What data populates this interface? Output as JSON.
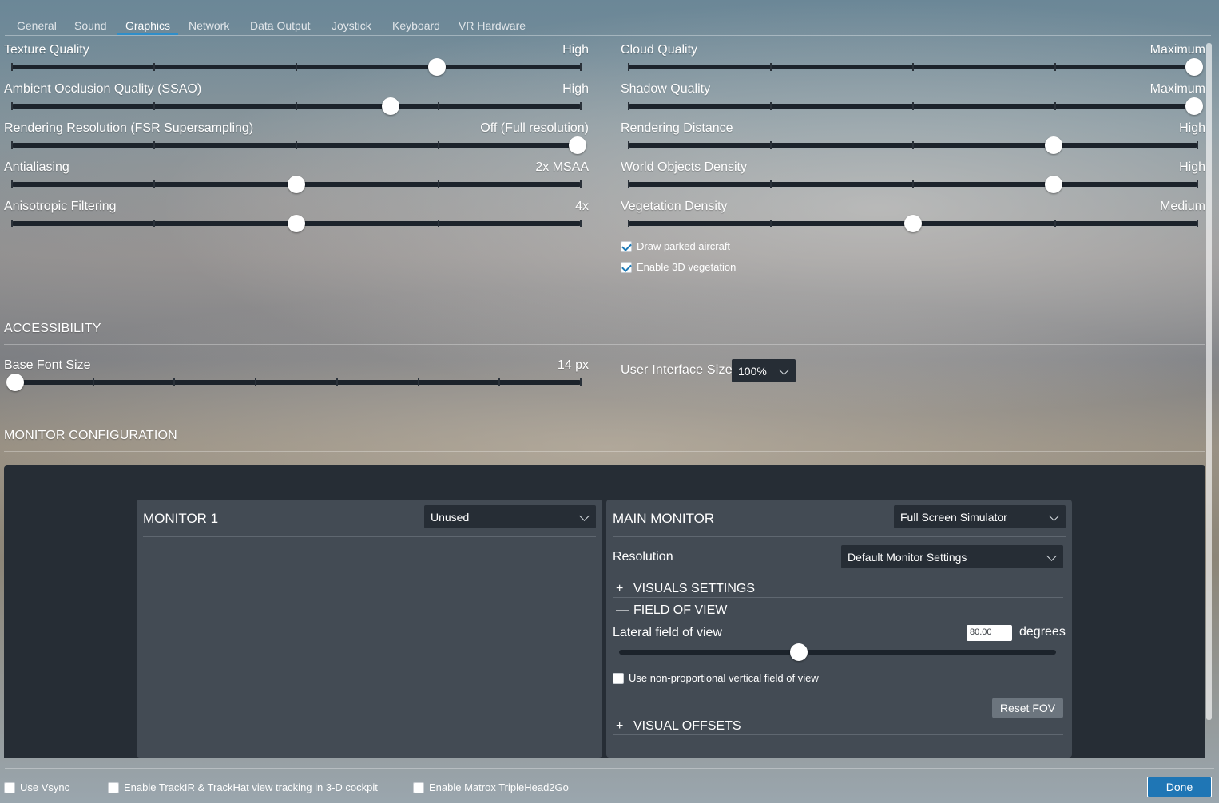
{
  "tabs": [
    "General",
    "Sound",
    "Graphics",
    "Network",
    "Data Output",
    "Joystick",
    "Keyboard",
    "VR Hardware"
  ],
  "active_tab": "Graphics",
  "graphics_left": [
    {
      "label": "Texture Quality",
      "value": "High",
      "level": 0.75
    },
    {
      "label": "Ambient Occlusion Quality (SSAO)",
      "value": "High",
      "level": 0.667
    },
    {
      "label": "Rendering Resolution (FSR Supersampling)",
      "value": "Off (Full resolution)",
      "level": 1.0
    },
    {
      "label": "Antialiasing",
      "value": "2x MSAA",
      "level": 0.5
    },
    {
      "label": "Anisotropic Filtering",
      "value": "4x",
      "level": 0.5
    }
  ],
  "graphics_right": [
    {
      "label": "Cloud Quality",
      "value": "Maximum",
      "level": 1.0
    },
    {
      "label": "Shadow Quality",
      "value": "Maximum",
      "level": 1.0
    },
    {
      "label": "Rendering Distance",
      "value": "High",
      "level": 0.75
    },
    {
      "label": "World Objects Density",
      "value": "High",
      "level": 0.75
    },
    {
      "label": "Vegetation Density",
      "value": "Medium",
      "level": 0.5
    }
  ],
  "checkboxes": {
    "draw_parked_aircraft": {
      "label": "Draw parked aircraft",
      "checked": true
    },
    "enable_3d_vegetation": {
      "label": "Enable 3D vegetation",
      "checked": true
    }
  },
  "accessibility": {
    "title": "ACCESSIBILITY",
    "base_font_size": {
      "label": "Base Font Size",
      "value": "14 px",
      "level": 0.0
    },
    "ui_size": {
      "label": "User Interface Size",
      "value": "100%"
    }
  },
  "monitor_config": {
    "title": "MONITOR CONFIGURATION",
    "monitor1": {
      "title": "MONITOR 1",
      "mode": "Unused"
    },
    "main_monitor": {
      "title": "MAIN MONITOR",
      "mode": "Full Screen Simulator",
      "resolution_label": "Resolution",
      "resolution_value": "Default Monitor Settings",
      "visuals_settings": "VISUALS SETTINGS",
      "field_of_view": "FIELD OF VIEW",
      "lateral_fov_label": "Lateral field of view",
      "lateral_fov_value": "80.00",
      "fov_unit": "degrees",
      "fov_level": 0.41,
      "nonprop_label": "Use non-proportional vertical field of view",
      "nonprop_checked": false,
      "reset_fov": "Reset FOV",
      "visual_offsets": "VISUAL OFFSETS",
      "expand_symbol": "+",
      "collapse_symbol": "—"
    }
  },
  "bottom": {
    "use_vsync": {
      "label": "Use Vsync",
      "checked": false
    },
    "trackir": {
      "label": "Enable TrackIR & TrackHat view tracking in 3-D cockpit",
      "checked": false
    },
    "matrox": {
      "label": "Enable Matrox TripleHead2Go",
      "checked": false
    },
    "done": "Done"
  }
}
